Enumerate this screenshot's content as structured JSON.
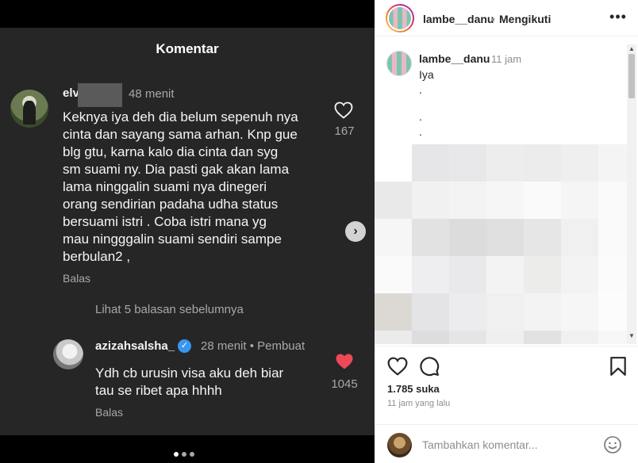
{
  "media": {
    "screenshot": {
      "title": "Komentar",
      "comment1": {
        "username": "elv",
        "time": "48 menit",
        "text": "Keknya iya deh dia belum sepenuh nya\ncinta dan sayang sama arhan. Knp gue\nblg gtu, karna kalo dia cinta dan syg\nsm suami ny. Dia pasti gak akan lama\nlama ninggalin suami nya dinegeri\norang sendirian padaha udha status\nbersuami istri . Coba istri mana yg\nmau ningggalin suami sendiri sampe\nberbulan2 ,",
        "reply": "Balas",
        "likes": "167"
      },
      "view_previous": "Lihat 5 balasan sebelumnya",
      "comment2": {
        "username": "azizahsalsha_",
        "verified": "✓",
        "meta": "28 menit • Pembuat",
        "text": "Ydh cb urusin visa aku deh biar\ntau se ribet apa hhhh",
        "reply": "Balas",
        "likes": "1045"
      }
    },
    "next_icon": "›",
    "carousel_count": 3,
    "carousel_active": 0
  },
  "post": {
    "header": {
      "username": "lambe__danu",
      "separator": "•",
      "follow_status": "Mengikuti",
      "more_icon": "•••"
    },
    "caption": {
      "username": "lambe__danu",
      "time": "11 jam",
      "text": "Iya",
      "dots": [
        ".",
        ".",
        "."
      ]
    },
    "likes": "1.785 suka",
    "posted_time": "11 jam yang lalu",
    "comment_placeholder": "Tambahkan komentar...",
    "scroll_up": "▲",
    "scroll_down": "▼"
  },
  "colors": {
    "dark_bg": "#262626",
    "like_red": "#ed4956",
    "verified_blue": "#3897f0"
  }
}
